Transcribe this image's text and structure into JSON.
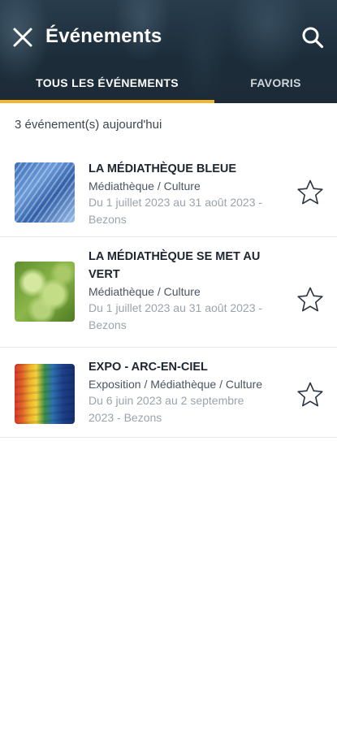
{
  "header": {
    "title": "Événements",
    "close_icon": "close-icon",
    "search_icon": "search-icon"
  },
  "tabs": [
    {
      "label": "TOUS LES ÉVÉNEMENTS",
      "active": true
    },
    {
      "label": "FAVORIS",
      "active": false
    }
  ],
  "count_text": "3 événement(s) aujourd'hui",
  "events": [
    {
      "title": "LA MÉDIATHÈQUE BLEUE",
      "category": "Médiathèque / Culture",
      "date_line1": "Du 1 juillet 2023 au 31 août 2023 -",
      "date_line2": "Bezons",
      "favorite_icon": "star-outline-icon"
    },
    {
      "title_line1": "LA MÉDIATHÈQUE SE MET AU",
      "title_line2": "VERT",
      "category": "Médiathèque / Culture",
      "date_line1": "Du 1 juillet 2023 au 31 août 2023 -",
      "date_line2": "Bezons",
      "favorite_icon": "star-outline-icon"
    },
    {
      "title": "EXPO - ARC-EN-CIEL",
      "category": "Exposition / Médiathèque / Culture",
      "date_line1": "Du 6 juin 2023 au 2 septembre",
      "date_line2": "2023 - Bezons",
      "favorite_icon": "star-outline-icon"
    }
  ],
  "colors": {
    "header_bg": "#1e2f3d",
    "tab_indicator": "#f2b630",
    "date_text": "#9aa3ad"
  }
}
